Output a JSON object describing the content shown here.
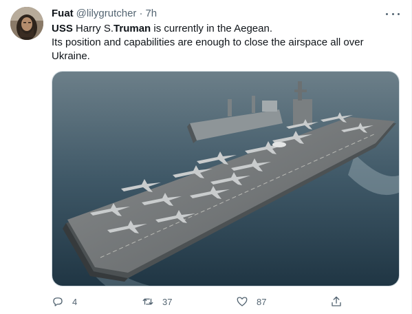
{
  "author": {
    "name": "Fuat",
    "handle": "@lilygrutcher",
    "separator": "·",
    "time": "7h"
  },
  "tweet": {
    "line1_bold_a": "USS",
    "line1_mid": " Harry S.",
    "line1_bold_b": "Truman",
    "line1_end": " is currently in the Aegean.",
    "line2": "Its position and capabilities are enough to close the airspace all over",
    "line3": "Ukraine."
  },
  "media": {
    "description_icon": "aircraft-carrier-photo"
  },
  "actions": {
    "reply_count": "4",
    "retweet_count": "37",
    "like_count": "87"
  },
  "colors": {
    "text": "#0f1419",
    "secondary": "#536471",
    "border": "#cfd9de",
    "sea": "#3e5766"
  }
}
